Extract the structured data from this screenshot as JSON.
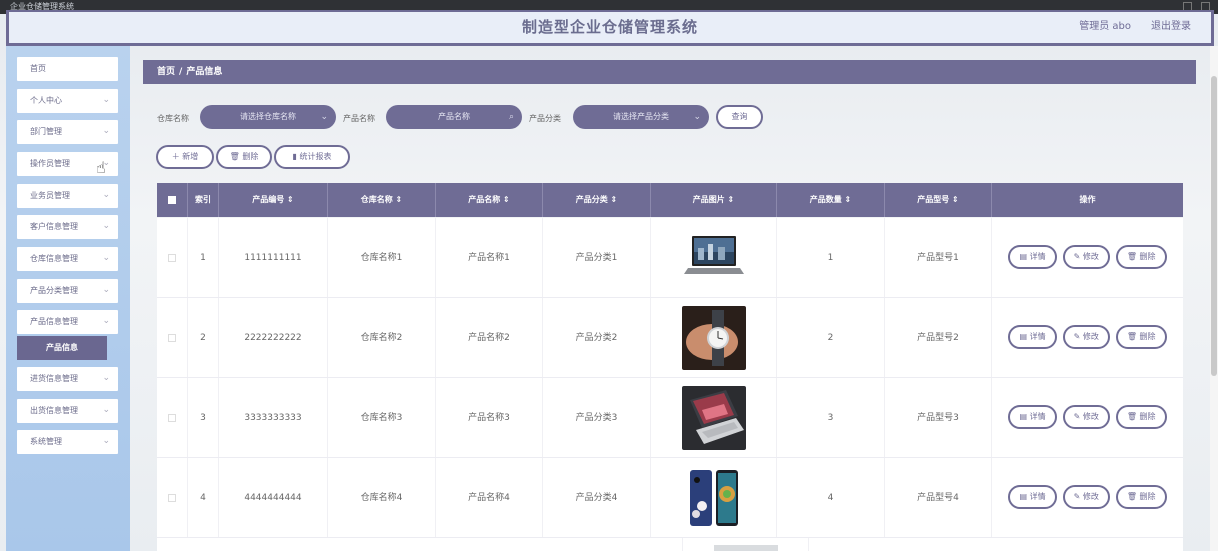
{
  "window": {
    "title": "企业仓储管理系统"
  },
  "header": {
    "title": "制造型企业仓储管理系统",
    "admin": "管理员 abo",
    "logout": "退出登录"
  },
  "sidebar": {
    "items": [
      {
        "label": "首页"
      },
      {
        "label": "个人中心"
      },
      {
        "label": "部门管理"
      },
      {
        "label": "操作员管理"
      },
      {
        "label": "业务员管理"
      },
      {
        "label": "客户信息管理"
      },
      {
        "label": "仓库信息管理"
      },
      {
        "label": "产品分类管理"
      },
      {
        "label": "产品信息管理"
      },
      {
        "label": "进货信息管理"
      },
      {
        "label": "出货信息管理"
      },
      {
        "label": "系统管理"
      }
    ],
    "active_sub": "产品信息"
  },
  "breadcrumb": {
    "home": "首页",
    "sep": "/",
    "current": "产品信息"
  },
  "search": {
    "warehouse_label": "仓库名称",
    "warehouse_placeholder": "请选择仓库名称",
    "product_label": "产品名称",
    "product_placeholder": "产品名称",
    "category_label": "产品分类",
    "category_placeholder": "请选择产品分类",
    "query": "查询"
  },
  "toolbar": {
    "add": "＋ 新增",
    "delete": "删除",
    "report": "统计报表"
  },
  "table": {
    "headers": [
      "",
      "索引",
      "产品编号 ⇕",
      "仓库名称 ⇕",
      "产品名称 ⇕",
      "产品分类 ⇕",
      "产品图片 ⇕",
      "产品数量 ⇕",
      "产品型号 ⇕",
      "操作"
    ],
    "rows": [
      {
        "index": "1",
        "code": "1111111111",
        "warehouse": "仓库名称1",
        "name": "产品名称1",
        "category": "产品分类1",
        "image": "laptop",
        "qty": "1",
        "model": "产品型号1"
      },
      {
        "index": "2",
        "code": "2222222222",
        "warehouse": "仓库名称2",
        "name": "产品名称2",
        "category": "产品分类2",
        "image": "watch",
        "qty": "2",
        "model": "产品型号2"
      },
      {
        "index": "3",
        "code": "3333333333",
        "warehouse": "仓库名称3",
        "name": "产品名称3",
        "category": "产品分类3",
        "image": "notebook",
        "qty": "3",
        "model": "产品型号3"
      },
      {
        "index": "4",
        "code": "4444444444",
        "warehouse": "仓库名称4",
        "name": "产品名称4",
        "category": "产品分类4",
        "image": "phone",
        "qty": "4",
        "model": "产品型号4"
      }
    ],
    "actions": {
      "detail": "详情",
      "edit": "修改",
      "delete": "删除"
    }
  },
  "colors": {
    "primary": "#6f6c95",
    "sidebar_bg": "#b0cced",
    "header_bg": "#e9eef8"
  }
}
